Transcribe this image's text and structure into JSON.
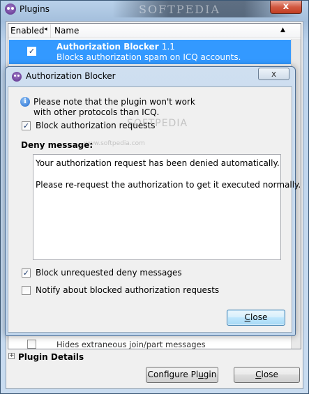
{
  "window": {
    "title": "Plugins",
    "watermark": "SOFTPEDIA",
    "close_glyph": "x"
  },
  "list": {
    "columns": {
      "enabled": "Enabled",
      "name": "Name"
    },
    "sort_left_glyph": "◂",
    "sort_up_glyph": "▲",
    "selected_row": {
      "title": "Authorization Blocker",
      "version": "1.1",
      "description": "Blocks authorization spam on ICQ accounts.",
      "checked": "✓"
    },
    "partial_row": {
      "description": "Hides extraneous join/part messages"
    }
  },
  "details": {
    "expander": "+",
    "label": "Plugin Details"
  },
  "buttons": {
    "configure": {
      "pre": "Configure Pl",
      "accel": "u",
      "post": "gin"
    },
    "close": {
      "accel": "C",
      "post": "lose"
    }
  },
  "dialog": {
    "title": "Authorization Blocker",
    "close_glyph": "x",
    "info_glyph": "i",
    "note_line1": "Please note that the plugin won't work",
    "note_line2": "with other protocols than ICQ.",
    "block_requests": {
      "label": "Block authorization requests",
      "checked": "✓"
    },
    "deny_label": "Deny message:",
    "deny_line1": "Your authorization request has been denied automatically.",
    "deny_line2": "Please re-request the authorization to get it executed normally.",
    "block_unrequested": {
      "label": "Block unrequested deny messages",
      "checked": "✓"
    },
    "notify_blocked": {
      "label": "Notify about blocked authorization requests",
      "checked": ""
    },
    "close_button": {
      "accel": "C",
      "post": "lose"
    },
    "watermark": "SOFTPEDIA",
    "watermark_url": "www.softpedia.com"
  }
}
